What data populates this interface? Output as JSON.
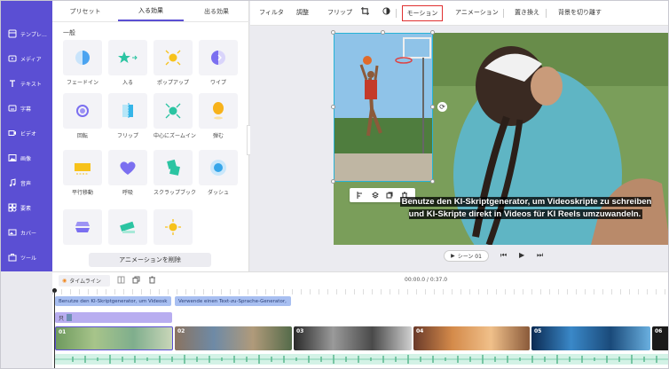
{
  "nav": {
    "items": [
      "テンプレ…",
      "メディア",
      "テキスト",
      "字幕",
      "ビデオ",
      "画像",
      "音声",
      "要素",
      "カバー",
      "ツール"
    ]
  },
  "panel": {
    "tabs": [
      "プリセット",
      "入る効果",
      "出る効果"
    ],
    "active_tab": "入る効果",
    "section": "一般",
    "effects": [
      "フェードイン",
      "入る",
      "ポップアップ",
      "ワイプ",
      "回転",
      "フリップ",
      "中心にズームイン",
      "弾む",
      "平行移動",
      "呼吸",
      "スクラップブック",
      "ダッシュ",
      "",
      "",
      ""
    ],
    "delete_label": "アニメーションを削除"
  },
  "toolbar": {
    "items": [
      "フィルタ",
      "調整",
      "フリップ"
    ],
    "motion": "モーション",
    "animation": "アニメーション",
    "replace": "置き換え",
    "remove_bg": "背景を切り離す"
  },
  "preview": {
    "subtitle": "Benutze den KI-Skriptgenerator, um Videoskripte zu schreiben und KI-Skripte direkt in Videos für KI Reels umzuwandeln.",
    "scene_label": "シーン 01"
  },
  "timeline": {
    "button": "タイムライン",
    "time": "00:00.0 / 0:37.0",
    "text_clips": [
      "Benutze den KI-Skriptgenerator, um Videosk",
      "Verwende einen Text-zu-Sprache-Generator,"
    ],
    "pip_label": "只",
    "scenes": [
      "01",
      "02",
      "03",
      "04",
      "05",
      "06"
    ]
  },
  "colors": {
    "accent": "#5b4fd3",
    "highlight": "#e03030",
    "selection": "#27b3d6"
  }
}
